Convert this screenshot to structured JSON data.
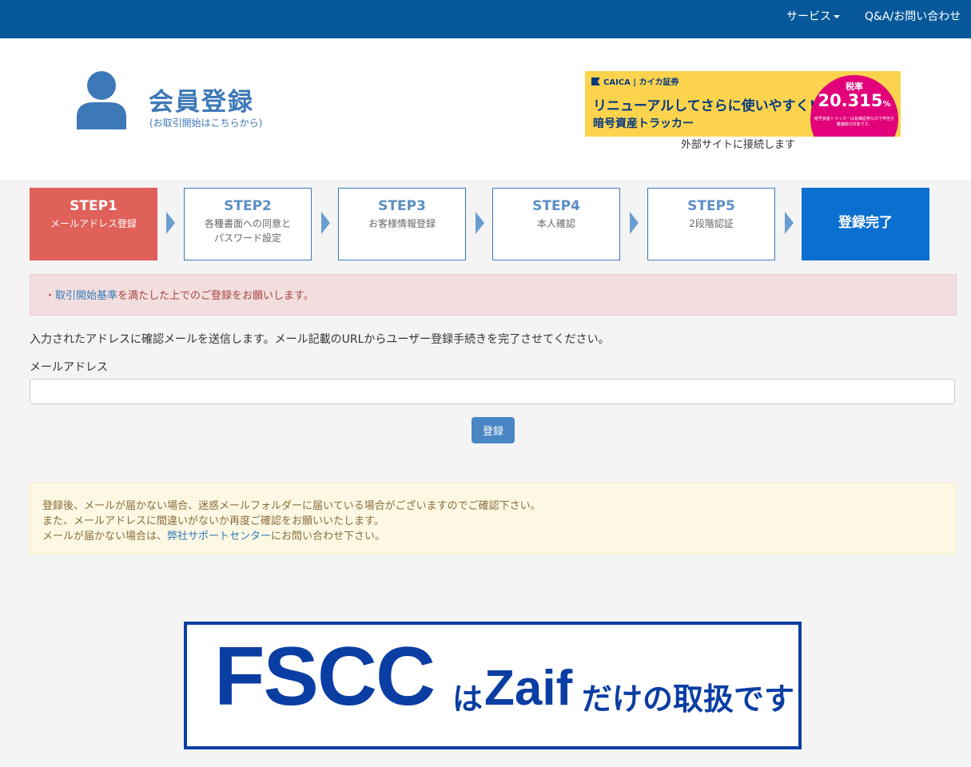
{
  "nav": {
    "services_label": "サービス",
    "qa_label": "Q&A/お問い合わせ"
  },
  "header": {
    "title": "会員登録",
    "subtitle": "(お取引開始はこちらから)"
  },
  "banner": {
    "brand": "CAICA | カイカ証券",
    "headline": "リニューアルしてさらに使いやすく!",
    "subline": "暗号資産トラッカー",
    "rate_label": "税率",
    "rate_value": "20.315",
    "rate_unit": "%",
    "fine_print": "暗号資産トラッカーは有価証券なので申告分離課税の対象です。",
    "caption": "外部サイトに接続します"
  },
  "steps": [
    {
      "title": "STEP1",
      "desc": "メールアドレス登録"
    },
    {
      "title": "STEP2",
      "desc": "各種書面への同意と\nパスワード設定"
    },
    {
      "title": "STEP3",
      "desc": "お客様情報登録"
    },
    {
      "title": "STEP4",
      "desc": "本人確認"
    },
    {
      "title": "STEP5",
      "desc": "2段階認証"
    },
    {
      "title": "登録完了",
      "desc": ""
    }
  ],
  "alert": {
    "bullet": "・",
    "link": "取引開始基準",
    "text": "を満たした上でのご登録をお願いします。"
  },
  "form": {
    "info_text": "入力されたアドレスに確認メールを送信します。メール記載のURLからユーザー登録手続きを完了させてください。",
    "email_label": "メールアドレス",
    "email_value": "",
    "submit_label": "登録"
  },
  "notice": {
    "line1": "登録後、メールが届かない場合、迷惑メールフォルダーに届いている場合がございますのでご確認下さい。",
    "line2": "また、メールアドレスに間違いがないか再度ご確認をお願いいたします。",
    "line3_pre": "メールが届かない場合は、",
    "line3_link": "弊社サポートセンター",
    "line3_post": "にお問い合わせ下さい。"
  },
  "fscc_banner": {
    "big": "FSCC",
    "ha": "は",
    "zaif": "Zaif",
    "rest": "だけの取扱です"
  }
}
